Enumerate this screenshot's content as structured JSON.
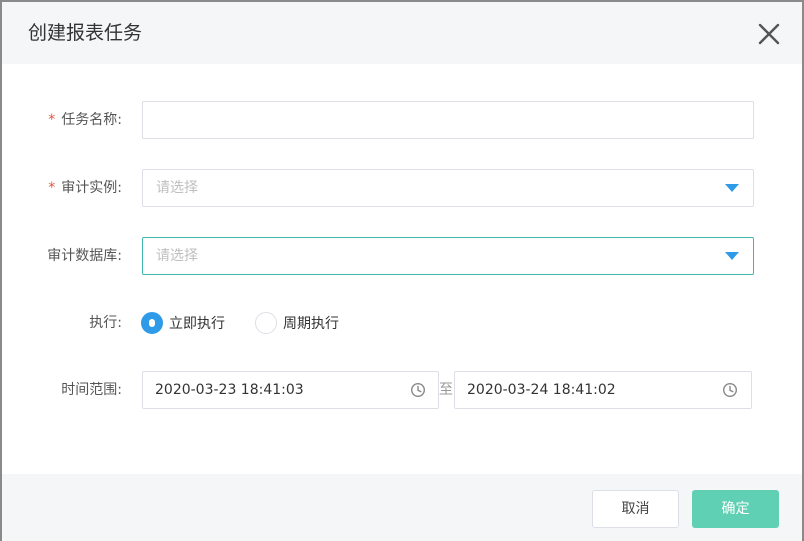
{
  "dialog": {
    "title": "创建报表任务",
    "close_icon": "close-icon"
  },
  "form": {
    "task_name": {
      "label": "任务名称:",
      "required_mark": "*",
      "value": ""
    },
    "audit_instance": {
      "label": "审计实例:",
      "required_mark": "*",
      "placeholder": "请选择",
      "icon": "caret-down-icon"
    },
    "audit_database": {
      "label": "审计数据库:",
      "placeholder": "请选择",
      "icon": "caret-down-icon"
    },
    "execute": {
      "label": "执行:",
      "options": [
        {
          "label": "立即执行",
          "checked": true
        },
        {
          "label": "周期执行",
          "checked": false
        }
      ]
    },
    "time_range": {
      "label": "时间范围:",
      "start": "2020-03-23 18:41:03",
      "separator": "至",
      "end": "2020-03-24 18:41:02",
      "icon": "clock-icon"
    }
  },
  "footer": {
    "cancel_label": "取消",
    "ok_label": "确定"
  },
  "colors": {
    "accent": "#2f9be8",
    "focus_border": "#3fb6b0",
    "ok_button": "#5fd0b3",
    "required": "#e5533d"
  }
}
